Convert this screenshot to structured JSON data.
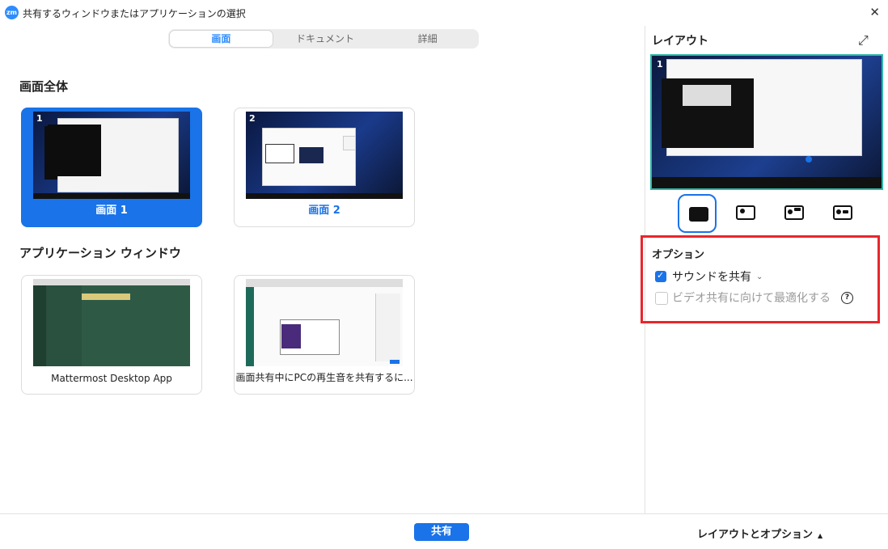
{
  "window": {
    "title": "共有するウィンドウまたはアプリケーションの選択",
    "logo": "zm"
  },
  "tabs": [
    {
      "label": "画面",
      "active": true
    },
    {
      "label": "ドキュメント",
      "active": false
    },
    {
      "label": "詳細",
      "active": false
    }
  ],
  "sections": {
    "screens": "画面全体",
    "apps": "アプリケーション ウィンドウ"
  },
  "screens": [
    {
      "label": "画面 1",
      "badge": "1",
      "selected": true
    },
    {
      "label": "画面 2",
      "badge": "2",
      "selected": false
    }
  ],
  "apps": [
    {
      "label": "Mattermost Desktop App"
    },
    {
      "label": "画面共有中にPCの再生音を共有するに..."
    }
  ],
  "right_panel": {
    "title": "レイアウト",
    "preview_badge": "1"
  },
  "options": {
    "title": "オプション",
    "share_sound": {
      "label": "サウンドを共有",
      "checked": true
    },
    "optimize_video": {
      "label": "ビデオ共有に向けて最適化する",
      "checked": false,
      "disabled": true
    }
  },
  "footer": {
    "share_label": "共有",
    "layout_options_label": "レイアウトとオプション"
  },
  "colors": {
    "accent": "#1a73e8",
    "highlight_border": "#e8262c"
  }
}
